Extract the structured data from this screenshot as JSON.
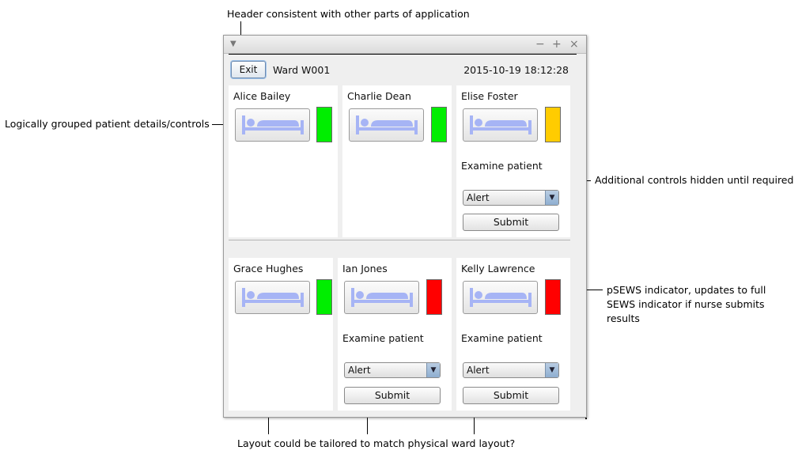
{
  "annotations": {
    "header": "Header consistent with other parts of application",
    "grouped": "Logically grouped patient details/controls",
    "hidden_controls": "Additional controls hidden until required",
    "psews": "pSEWS indicator, updates to full SEWS indicator if nurse submits results",
    "layout": "Layout could be tailored to match physical ward layout?"
  },
  "window": {
    "menu_icon": "chevron-down-icon",
    "minimize": "−",
    "maximize": "+",
    "close": "×",
    "exit_label": "Exit",
    "ward_label": "Ward  W001",
    "datetime": "2015-10-19 18:12:28"
  },
  "colors": {
    "green": "#00ee00",
    "amber": "#ffcc00",
    "red": "#ff0000",
    "bed_icon": "#a6b4f5"
  },
  "patients": [
    {
      "name": "Alice Bailey",
      "indicator": "green"
    },
    {
      "name": "Charlie Dean",
      "indicator": "green"
    },
    {
      "name": "Elise Foster",
      "indicator": "amber",
      "examine_label": "Examine patient",
      "select_value": "Alert",
      "submit_label": "Submit"
    },
    {
      "name": "Grace Hughes",
      "indicator": "green"
    },
    {
      "name": "Ian Jones",
      "indicator": "red",
      "examine_label": "Examine patient",
      "select_value": "Alert",
      "submit_label": "Submit"
    },
    {
      "name": "Kelly Lawrence",
      "indicator": "red",
      "examine_label": "Examine patient",
      "select_value": "Alert",
      "submit_label": "Submit"
    }
  ]
}
